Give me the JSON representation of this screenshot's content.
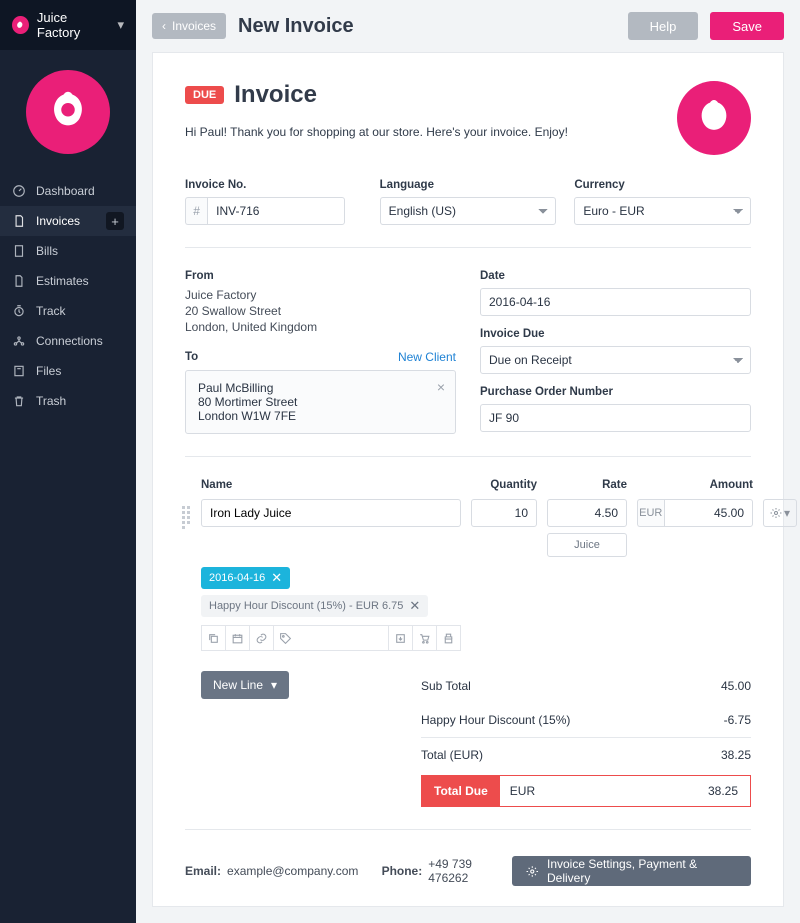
{
  "brand": {
    "name": "Juice Factory"
  },
  "sidebar": {
    "items": [
      {
        "label": "Dashboard"
      },
      {
        "label": "Invoices"
      },
      {
        "label": "Bills"
      },
      {
        "label": "Estimates"
      },
      {
        "label": "Track"
      },
      {
        "label": "Connections"
      },
      {
        "label": "Files"
      },
      {
        "label": "Trash"
      }
    ]
  },
  "topbar": {
    "back": "Invoices",
    "title": "New Invoice",
    "help": "Help",
    "save": "Save"
  },
  "doc": {
    "badge": "DUE",
    "title": "Invoice",
    "greeting": "Hi Paul! Thank you for shopping at our store. Here's your invoice. Enjoy!"
  },
  "fields": {
    "invoice_no_label": "Invoice No.",
    "invoice_no_prefix": "#",
    "invoice_no": "INV-716",
    "language_label": "Language",
    "language_value": "English (US)",
    "currency_label": "Currency",
    "currency_value": "Euro - EUR"
  },
  "from": {
    "label": "From",
    "name": "Juice Factory",
    "line1": "20 Swallow Street",
    "line2": "London, United Kingdom"
  },
  "to": {
    "label": "To",
    "new_client": "New Client",
    "name": "Paul McBilling",
    "line1": "80 Mortimer Street",
    "line2": "London W1W 7FE"
  },
  "right": {
    "date_label": "Date",
    "date_value": "2016-04-16",
    "due_label": "Invoice Due",
    "due_value": "Due on Receipt",
    "po_label": "Purchase Order Number",
    "po_value": "JF 90"
  },
  "lines": {
    "headers": {
      "name": "Name",
      "qty": "Quantity",
      "rate": "Rate",
      "amount": "Amount"
    },
    "item": {
      "name": "Iron Lady Juice",
      "qty": "10",
      "rate": "4.50",
      "cur": "EUR",
      "amount": "45.00",
      "unit": "Juice",
      "date_tag": "2016-04-16",
      "discount_tag": "Happy Hour Discount (15%) - EUR 6.75"
    },
    "new_line": "New Line"
  },
  "totals": {
    "sub_label": "Sub Total",
    "sub_value": "45.00",
    "disc_label": "Happy Hour Discount (15%)",
    "disc_value": "-6.75",
    "total_label": "Total (EUR)",
    "total_value": "38.25",
    "due_label": "Total Due",
    "due_cur": "EUR",
    "due_value": "38.25"
  },
  "footer": {
    "email_label": "Email:",
    "email": "example@company.com",
    "phone_label": "Phone:",
    "phone": "+49 739 476262",
    "settings": "Invoice Settings, Payment & Delivery"
  }
}
